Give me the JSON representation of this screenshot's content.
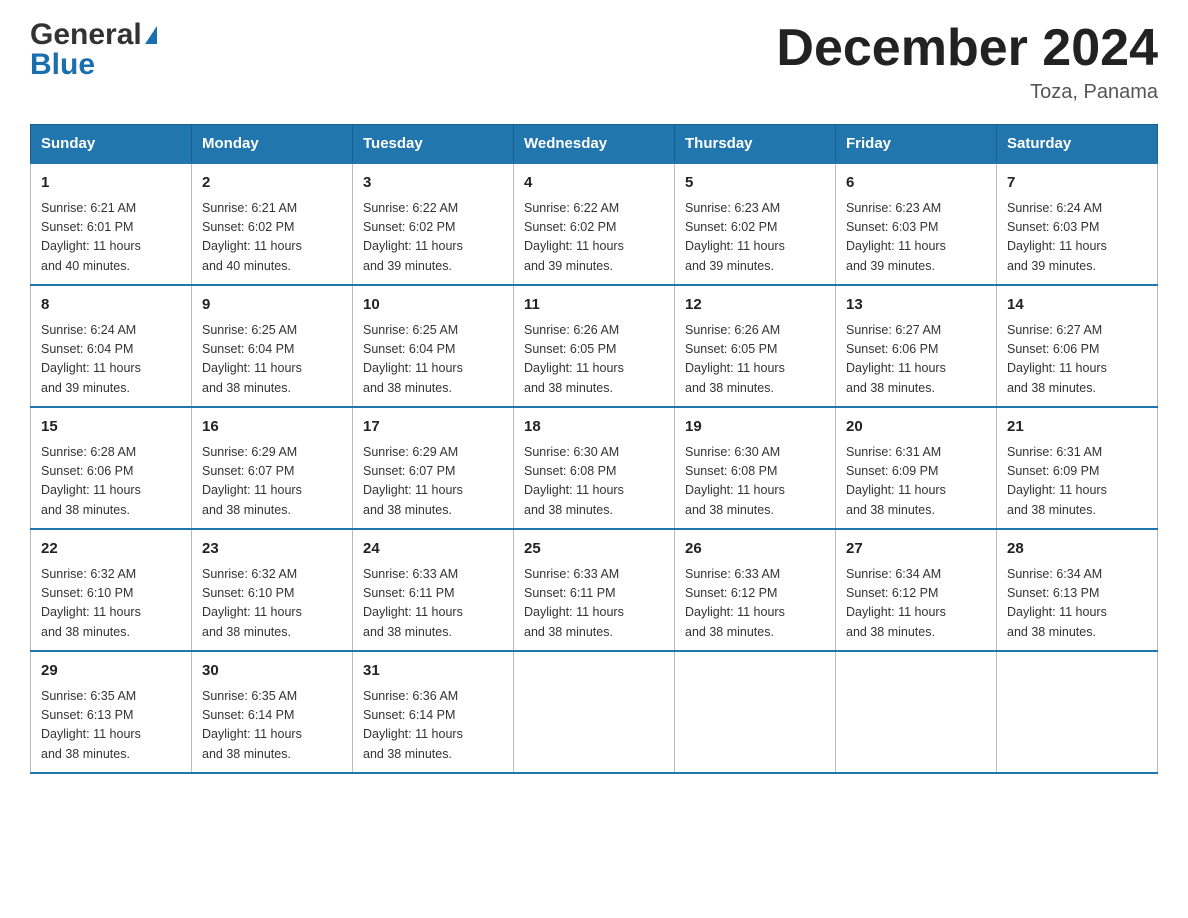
{
  "logo": {
    "general": "General",
    "blue": "Blue"
  },
  "title": {
    "month": "December 2024",
    "location": "Toza, Panama"
  },
  "headers": [
    "Sunday",
    "Monday",
    "Tuesday",
    "Wednesday",
    "Thursday",
    "Friday",
    "Saturday"
  ],
  "weeks": [
    [
      {
        "day": "1",
        "sunrise": "6:21 AM",
        "sunset": "6:01 PM",
        "daylight": "11 hours and 40 minutes."
      },
      {
        "day": "2",
        "sunrise": "6:21 AM",
        "sunset": "6:02 PM",
        "daylight": "11 hours and 40 minutes."
      },
      {
        "day": "3",
        "sunrise": "6:22 AM",
        "sunset": "6:02 PM",
        "daylight": "11 hours and 39 minutes."
      },
      {
        "day": "4",
        "sunrise": "6:22 AM",
        "sunset": "6:02 PM",
        "daylight": "11 hours and 39 minutes."
      },
      {
        "day": "5",
        "sunrise": "6:23 AM",
        "sunset": "6:02 PM",
        "daylight": "11 hours and 39 minutes."
      },
      {
        "day": "6",
        "sunrise": "6:23 AM",
        "sunset": "6:03 PM",
        "daylight": "11 hours and 39 minutes."
      },
      {
        "day": "7",
        "sunrise": "6:24 AM",
        "sunset": "6:03 PM",
        "daylight": "11 hours and 39 minutes."
      }
    ],
    [
      {
        "day": "8",
        "sunrise": "6:24 AM",
        "sunset": "6:04 PM",
        "daylight": "11 hours and 39 minutes."
      },
      {
        "day": "9",
        "sunrise": "6:25 AM",
        "sunset": "6:04 PM",
        "daylight": "11 hours and 38 minutes."
      },
      {
        "day": "10",
        "sunrise": "6:25 AM",
        "sunset": "6:04 PM",
        "daylight": "11 hours and 38 minutes."
      },
      {
        "day": "11",
        "sunrise": "6:26 AM",
        "sunset": "6:05 PM",
        "daylight": "11 hours and 38 minutes."
      },
      {
        "day": "12",
        "sunrise": "6:26 AM",
        "sunset": "6:05 PM",
        "daylight": "11 hours and 38 minutes."
      },
      {
        "day": "13",
        "sunrise": "6:27 AM",
        "sunset": "6:06 PM",
        "daylight": "11 hours and 38 minutes."
      },
      {
        "day": "14",
        "sunrise": "6:27 AM",
        "sunset": "6:06 PM",
        "daylight": "11 hours and 38 minutes."
      }
    ],
    [
      {
        "day": "15",
        "sunrise": "6:28 AM",
        "sunset": "6:06 PM",
        "daylight": "11 hours and 38 minutes."
      },
      {
        "day": "16",
        "sunrise": "6:29 AM",
        "sunset": "6:07 PM",
        "daylight": "11 hours and 38 minutes."
      },
      {
        "day": "17",
        "sunrise": "6:29 AM",
        "sunset": "6:07 PM",
        "daylight": "11 hours and 38 minutes."
      },
      {
        "day": "18",
        "sunrise": "6:30 AM",
        "sunset": "6:08 PM",
        "daylight": "11 hours and 38 minutes."
      },
      {
        "day": "19",
        "sunrise": "6:30 AM",
        "sunset": "6:08 PM",
        "daylight": "11 hours and 38 minutes."
      },
      {
        "day": "20",
        "sunrise": "6:31 AM",
        "sunset": "6:09 PM",
        "daylight": "11 hours and 38 minutes."
      },
      {
        "day": "21",
        "sunrise": "6:31 AM",
        "sunset": "6:09 PM",
        "daylight": "11 hours and 38 minutes."
      }
    ],
    [
      {
        "day": "22",
        "sunrise": "6:32 AM",
        "sunset": "6:10 PM",
        "daylight": "11 hours and 38 minutes."
      },
      {
        "day": "23",
        "sunrise": "6:32 AM",
        "sunset": "6:10 PM",
        "daylight": "11 hours and 38 minutes."
      },
      {
        "day": "24",
        "sunrise": "6:33 AM",
        "sunset": "6:11 PM",
        "daylight": "11 hours and 38 minutes."
      },
      {
        "day": "25",
        "sunrise": "6:33 AM",
        "sunset": "6:11 PM",
        "daylight": "11 hours and 38 minutes."
      },
      {
        "day": "26",
        "sunrise": "6:33 AM",
        "sunset": "6:12 PM",
        "daylight": "11 hours and 38 minutes."
      },
      {
        "day": "27",
        "sunrise": "6:34 AM",
        "sunset": "6:12 PM",
        "daylight": "11 hours and 38 minutes."
      },
      {
        "day": "28",
        "sunrise": "6:34 AM",
        "sunset": "6:13 PM",
        "daylight": "11 hours and 38 minutes."
      }
    ],
    [
      {
        "day": "29",
        "sunrise": "6:35 AM",
        "sunset": "6:13 PM",
        "daylight": "11 hours and 38 minutes."
      },
      {
        "day": "30",
        "sunrise": "6:35 AM",
        "sunset": "6:14 PM",
        "daylight": "11 hours and 38 minutes."
      },
      {
        "day": "31",
        "sunrise": "6:36 AM",
        "sunset": "6:14 PM",
        "daylight": "11 hours and 38 minutes."
      },
      null,
      null,
      null,
      null
    ]
  ],
  "labels": {
    "sunrise": "Sunrise:",
    "sunset": "Sunset:",
    "daylight": "Daylight:"
  }
}
